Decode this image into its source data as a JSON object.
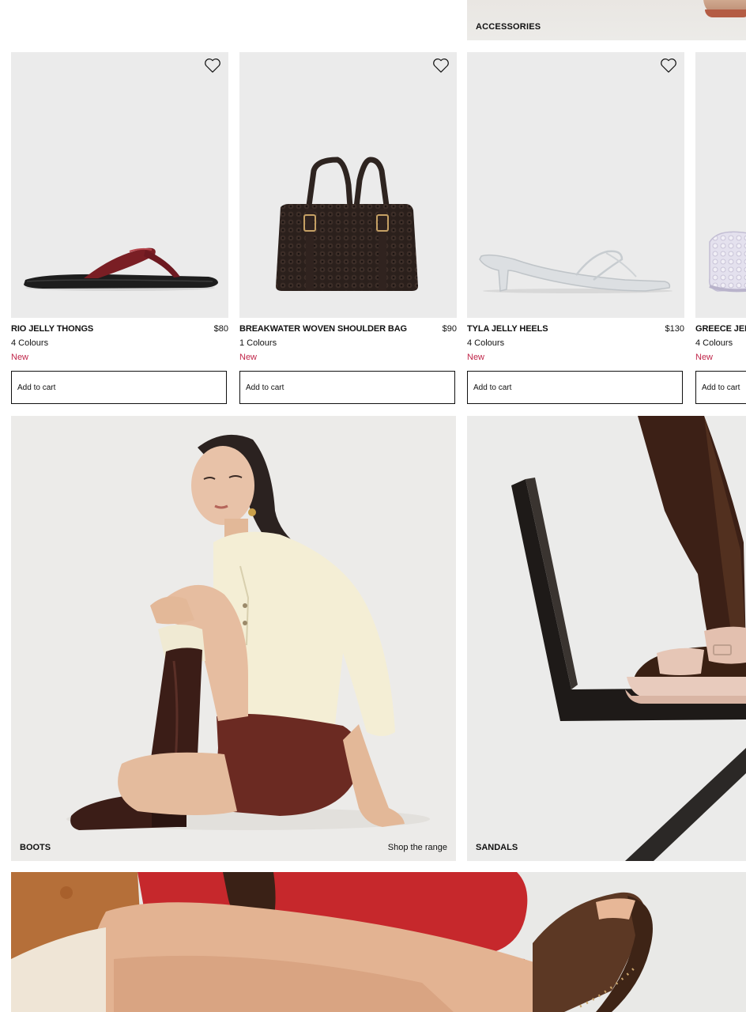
{
  "accessories_banner": {
    "label": "ACCESSORIES"
  },
  "products": [
    {
      "name": "RIO JELLY THONGS",
      "price": "$80",
      "colours": "4 Colours",
      "badge": "New",
      "cart": "Add to cart"
    },
    {
      "name": "BREAKWATER WOVEN SHOULDER BAG",
      "price": "$90",
      "colours": "1 Colours",
      "badge": "New",
      "cart": "Add to cart"
    },
    {
      "name": "TYLA JELLY HEELS",
      "price": "$130",
      "colours": "4 Colours",
      "badge": "New",
      "cart": "Add to cart"
    },
    {
      "name": "GREECE JEL",
      "price": "",
      "colours": "4 Colours",
      "badge": "New",
      "cart": "Add to cart"
    }
  ],
  "tiles": {
    "boots": {
      "label": "BOOTS",
      "cta": "Shop the range"
    },
    "sandals": {
      "label": "SANDALS"
    }
  },
  "icons": {
    "wishlist": "heart-outline-icon"
  },
  "colors": {
    "badge_new": "#c0264a",
    "card_bg": "#ebebeb",
    "border": "#111111"
  }
}
